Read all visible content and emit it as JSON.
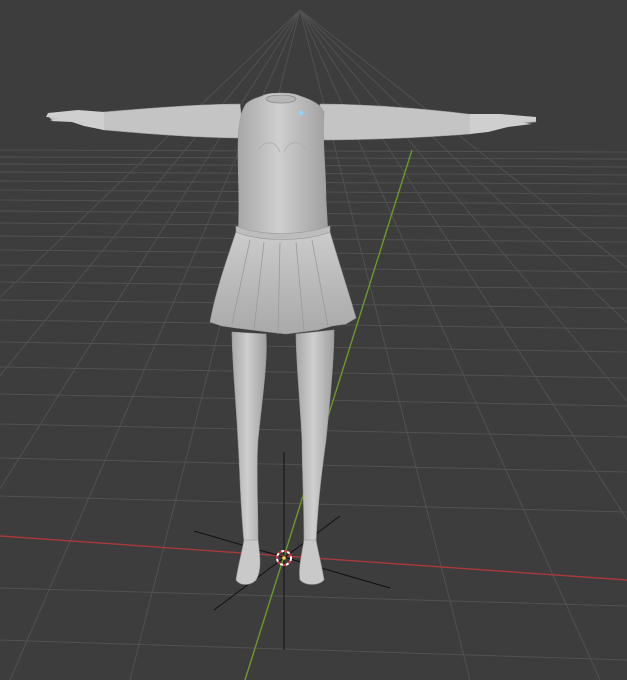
{
  "viewport": {
    "mode": "3d-viewport",
    "background_color": "#3d3d3d",
    "grid_color": "#555555",
    "x_axis_color": "#b13a3a",
    "y_axis_color": "#6d9b2e",
    "model_color": "#c6c6c6",
    "objects": {
      "model": "mannequin-figure",
      "origin": "object-origin-point",
      "cursor": "3d-cursor",
      "empty": "empty-axes"
    }
  }
}
